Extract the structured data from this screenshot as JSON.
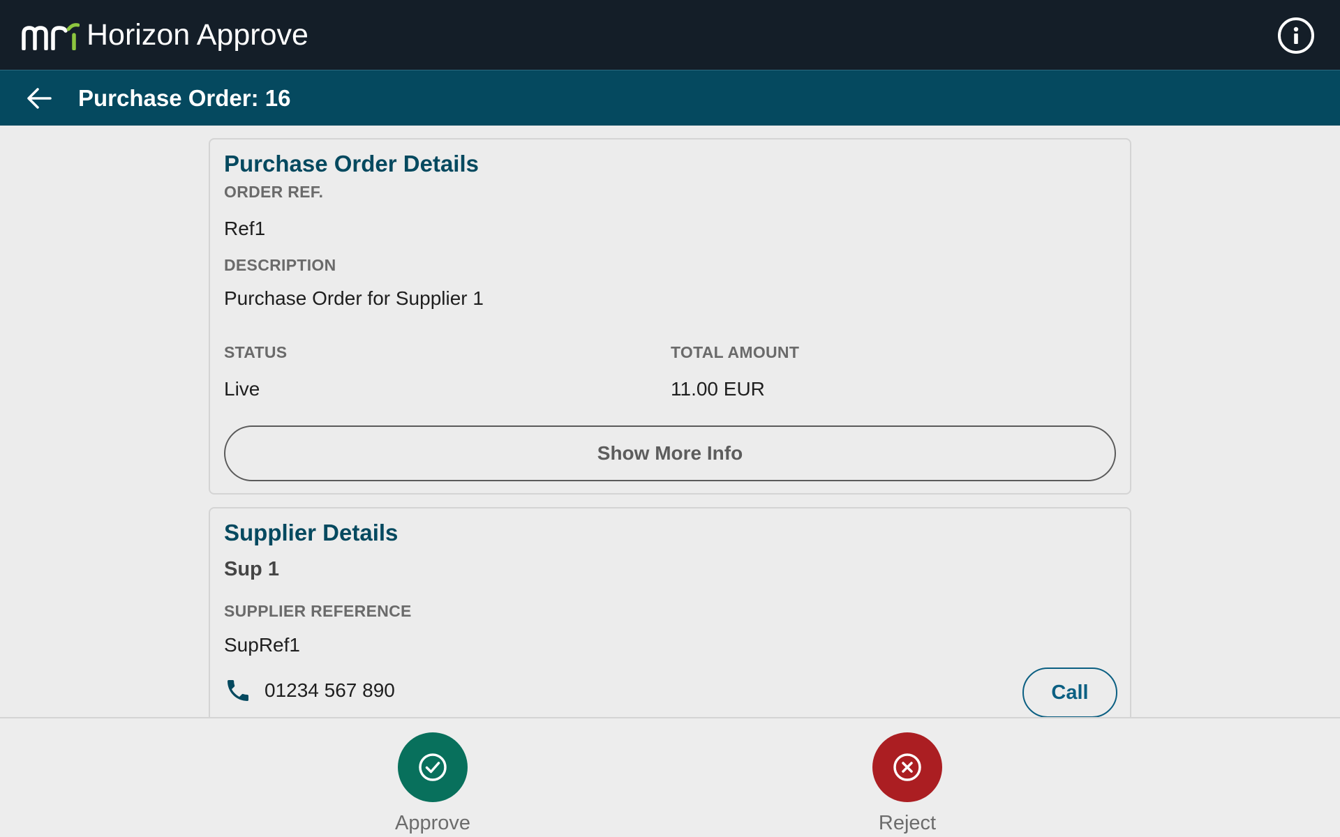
{
  "app": {
    "title": "Horizon Approve",
    "logo_text": "mri"
  },
  "header": {
    "page_title": "Purchase Order: 16"
  },
  "purchase_order": {
    "section_title": "Purchase Order Details",
    "order_ref_label": "ORDER REF.",
    "order_ref": "Ref1",
    "description_label": "DESCRIPTION",
    "description": "Purchase Order for Supplier 1",
    "status_label": "STATUS",
    "status": "Live",
    "total_label": "TOTAL AMOUNT",
    "total": "11.00 EUR",
    "more_button": "Show More Info"
  },
  "supplier": {
    "section_title": "Supplier Details",
    "name": "Sup 1",
    "reference_label": "SUPPLIER REFERENCE",
    "reference": "SupRef1",
    "phone": "01234 567 890",
    "call_button": "Call"
  },
  "actions": {
    "approve": "Approve",
    "reject": "Reject"
  },
  "colors": {
    "appbar": "#141e28",
    "subheader": "#05495f",
    "accent_logo": "#8dc63f",
    "approve": "#08705c",
    "reject": "#ab1e22"
  },
  "icons": [
    "mri-logo",
    "info-icon",
    "back-arrow-icon",
    "phone-icon",
    "check-circle-icon",
    "x-circle-icon"
  ]
}
